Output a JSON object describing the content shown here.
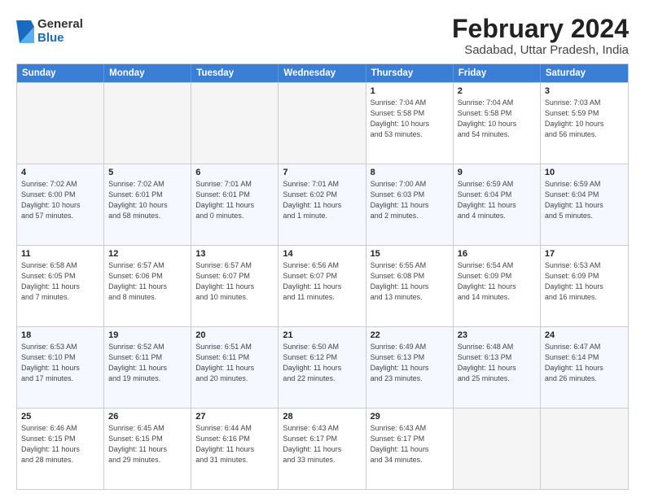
{
  "logo": {
    "general": "General",
    "blue": "Blue"
  },
  "title": "February 2024",
  "subtitle": "Sadabad, Uttar Pradesh, India",
  "header_days": [
    "Sunday",
    "Monday",
    "Tuesday",
    "Wednesday",
    "Thursday",
    "Friday",
    "Saturday"
  ],
  "weeks": [
    [
      {
        "day": "",
        "info": ""
      },
      {
        "day": "",
        "info": ""
      },
      {
        "day": "",
        "info": ""
      },
      {
        "day": "",
        "info": ""
      },
      {
        "day": "1",
        "info": "Sunrise: 7:04 AM\nSunset: 5:58 PM\nDaylight: 10 hours\nand 53 minutes."
      },
      {
        "day": "2",
        "info": "Sunrise: 7:04 AM\nSunset: 5:58 PM\nDaylight: 10 hours\nand 54 minutes."
      },
      {
        "day": "3",
        "info": "Sunrise: 7:03 AM\nSunset: 5:59 PM\nDaylight: 10 hours\nand 56 minutes."
      }
    ],
    [
      {
        "day": "4",
        "info": "Sunrise: 7:02 AM\nSunset: 6:00 PM\nDaylight: 10 hours\nand 57 minutes."
      },
      {
        "day": "5",
        "info": "Sunrise: 7:02 AM\nSunset: 6:01 PM\nDaylight: 10 hours\nand 58 minutes."
      },
      {
        "day": "6",
        "info": "Sunrise: 7:01 AM\nSunset: 6:01 PM\nDaylight: 11 hours\nand 0 minutes."
      },
      {
        "day": "7",
        "info": "Sunrise: 7:01 AM\nSunset: 6:02 PM\nDaylight: 11 hours\nand 1 minute."
      },
      {
        "day": "8",
        "info": "Sunrise: 7:00 AM\nSunset: 6:03 PM\nDaylight: 11 hours\nand 2 minutes."
      },
      {
        "day": "9",
        "info": "Sunrise: 6:59 AM\nSunset: 6:04 PM\nDaylight: 11 hours\nand 4 minutes."
      },
      {
        "day": "10",
        "info": "Sunrise: 6:59 AM\nSunset: 6:04 PM\nDaylight: 11 hours\nand 5 minutes."
      }
    ],
    [
      {
        "day": "11",
        "info": "Sunrise: 6:58 AM\nSunset: 6:05 PM\nDaylight: 11 hours\nand 7 minutes."
      },
      {
        "day": "12",
        "info": "Sunrise: 6:57 AM\nSunset: 6:06 PM\nDaylight: 11 hours\nand 8 minutes."
      },
      {
        "day": "13",
        "info": "Sunrise: 6:57 AM\nSunset: 6:07 PM\nDaylight: 11 hours\nand 10 minutes."
      },
      {
        "day": "14",
        "info": "Sunrise: 6:56 AM\nSunset: 6:07 PM\nDaylight: 11 hours\nand 11 minutes."
      },
      {
        "day": "15",
        "info": "Sunrise: 6:55 AM\nSunset: 6:08 PM\nDaylight: 11 hours\nand 13 minutes."
      },
      {
        "day": "16",
        "info": "Sunrise: 6:54 AM\nSunset: 6:09 PM\nDaylight: 11 hours\nand 14 minutes."
      },
      {
        "day": "17",
        "info": "Sunrise: 6:53 AM\nSunset: 6:09 PM\nDaylight: 11 hours\nand 16 minutes."
      }
    ],
    [
      {
        "day": "18",
        "info": "Sunrise: 6:53 AM\nSunset: 6:10 PM\nDaylight: 11 hours\nand 17 minutes."
      },
      {
        "day": "19",
        "info": "Sunrise: 6:52 AM\nSunset: 6:11 PM\nDaylight: 11 hours\nand 19 minutes."
      },
      {
        "day": "20",
        "info": "Sunrise: 6:51 AM\nSunset: 6:11 PM\nDaylight: 11 hours\nand 20 minutes."
      },
      {
        "day": "21",
        "info": "Sunrise: 6:50 AM\nSunset: 6:12 PM\nDaylight: 11 hours\nand 22 minutes."
      },
      {
        "day": "22",
        "info": "Sunrise: 6:49 AM\nSunset: 6:13 PM\nDaylight: 11 hours\nand 23 minutes."
      },
      {
        "day": "23",
        "info": "Sunrise: 6:48 AM\nSunset: 6:13 PM\nDaylight: 11 hours\nand 25 minutes."
      },
      {
        "day": "24",
        "info": "Sunrise: 6:47 AM\nSunset: 6:14 PM\nDaylight: 11 hours\nand 26 minutes."
      }
    ],
    [
      {
        "day": "25",
        "info": "Sunrise: 6:46 AM\nSunset: 6:15 PM\nDaylight: 11 hours\nand 28 minutes."
      },
      {
        "day": "26",
        "info": "Sunrise: 6:45 AM\nSunset: 6:15 PM\nDaylight: 11 hours\nand 29 minutes."
      },
      {
        "day": "27",
        "info": "Sunrise: 6:44 AM\nSunset: 6:16 PM\nDaylight: 11 hours\nand 31 minutes."
      },
      {
        "day": "28",
        "info": "Sunrise: 6:43 AM\nSunset: 6:17 PM\nDaylight: 11 hours\nand 33 minutes."
      },
      {
        "day": "29",
        "info": "Sunrise: 6:43 AM\nSunset: 6:17 PM\nDaylight: 11 hours\nand 34 minutes."
      },
      {
        "day": "",
        "info": ""
      },
      {
        "day": "",
        "info": ""
      }
    ]
  ]
}
